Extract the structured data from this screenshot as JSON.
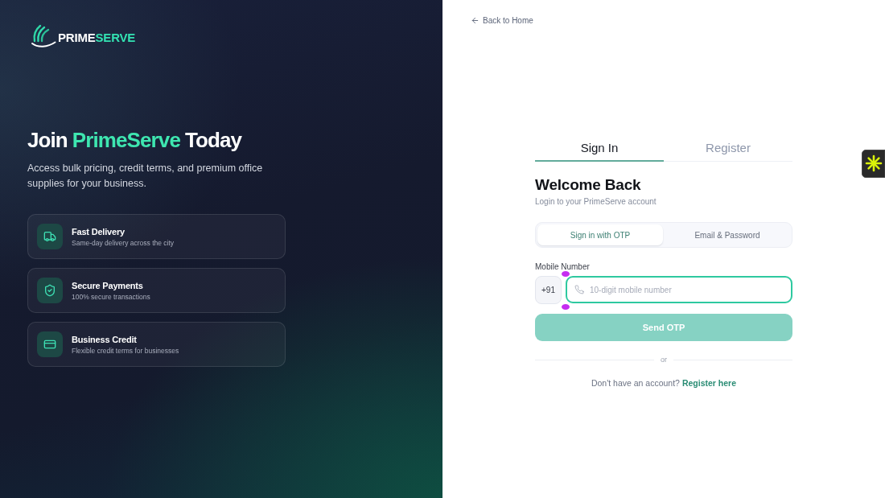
{
  "brand": {
    "logo_parts": [
      {
        "text": "PRIME",
        "accent": false
      },
      {
        "text": "SERVE",
        "accent": true
      }
    ]
  },
  "hero": {
    "heading_parts": [
      {
        "text": "Join",
        "accent": false
      },
      {
        "text": "PrimeServe",
        "accent": true
      },
      {
        "text": "Today",
        "accent": false
      }
    ],
    "description": "Access bulk pricing, credit terms, and premium office supplies for your business."
  },
  "features": [
    {
      "kind": "truck",
      "title": "Fast Delivery",
      "description": "Same-day delivery across the city"
    },
    {
      "kind": "shield",
      "title": "Secure Payments",
      "description": "100% secure transactions"
    },
    {
      "kind": "card",
      "title": "Business Credit",
      "description": "Flexible credit terms for businesses"
    }
  ],
  "back_link": {
    "label": "Back to Home"
  },
  "tabs": [
    {
      "label": "Sign In",
      "selected": true
    },
    {
      "label": "Register",
      "selected": false
    }
  ],
  "form": {
    "title": "Welcome Back",
    "subtitle": "Login to your PrimeServe account",
    "methods": [
      {
        "label": "Sign in with OTP",
        "selected": true
      },
      {
        "label": "Email & Password",
        "selected": false
      }
    ],
    "mobile": {
      "label": "Mobile Number",
      "country_code": "+91",
      "placeholder": "10-digit mobile number",
      "focused": true
    },
    "submit": {
      "label": "Send OTP",
      "disabled": true
    },
    "divider": "or",
    "footer": {
      "text": "Don't have an account?",
      "link": "Register here"
    }
  }
}
